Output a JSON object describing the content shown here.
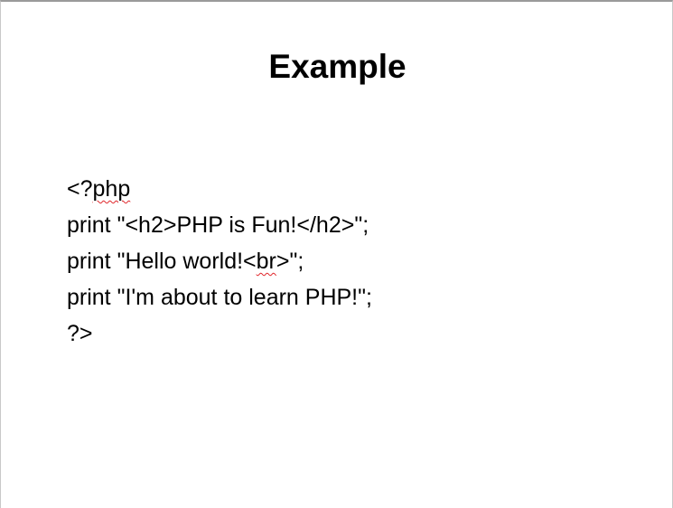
{
  "slide": {
    "title": "Example",
    "code": {
      "line1": {
        "prefix": "<?",
        "flagged": "php",
        "suffix": ""
      },
      "line2": "print \"<h2>PHP is Fun!</h2>\";",
      "line3": {
        "prefix": "print \"Hello world!<",
        "flagged": "br",
        "suffix": ">\";"
      },
      "line4": "print \"I'm about to learn PHP!\";",
      "line5": "?>"
    },
    "colors": {
      "background": "#ffffff",
      "text": "#000000",
      "spellcheck_underline": "#e0262a"
    }
  }
}
